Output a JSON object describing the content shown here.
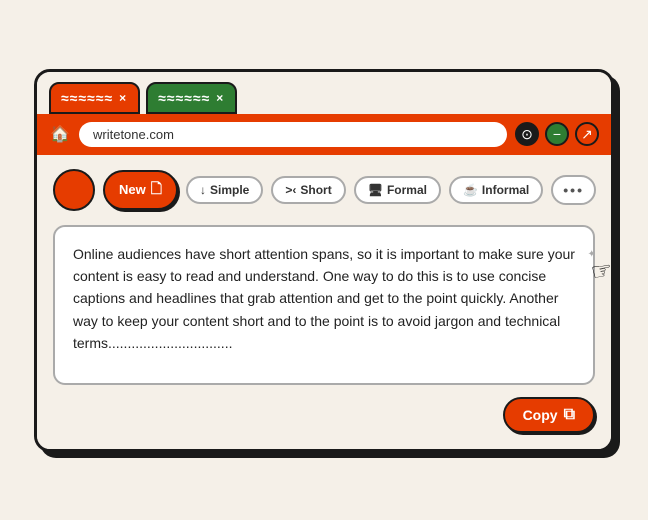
{
  "browser": {
    "tabs": [
      {
        "id": "tab1",
        "label": "≈≈≈≈≈≈",
        "active": true,
        "close": "×"
      },
      {
        "id": "tab2",
        "label": "≈≈≈≈≈≈",
        "active": false,
        "close": "×"
      }
    ],
    "addressBar": {
      "url": "writetone.com"
    },
    "controls": [
      {
        "id": "history",
        "symbol": "⊙"
      },
      {
        "id": "minimize",
        "symbol": "−"
      },
      {
        "id": "expand",
        "symbol": "⊕"
      }
    ]
  },
  "toolbar": {
    "new_label": "New",
    "new_icon": "🗋",
    "buttons": [
      {
        "id": "simple",
        "prefix": "↓",
        "label": "Simple"
      },
      {
        "id": "short",
        "prefix": ">‹",
        "label": "Short"
      },
      {
        "id": "formal",
        "prefix": "🖥",
        "label": "Formal"
      },
      {
        "id": "informal",
        "prefix": "☕",
        "label": "Informal"
      }
    ],
    "more": "•••"
  },
  "content": {
    "text": "Online audiences have short attention spans, so it is important to make sure your content is easy to read and understand. One way to do this is to use concise captions and headlines that grab attention and get to the point quickly. Another way to keep your content short and to the point is to avoid jargon and technical terms................................"
  },
  "copyButton": {
    "label": "Copy",
    "icon": "⧉"
  }
}
